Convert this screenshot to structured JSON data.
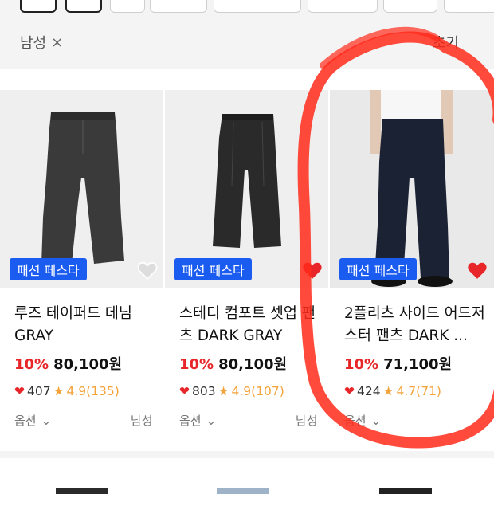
{
  "filter": {
    "active": "남성",
    "remove_icon": "×",
    "reset_label": "초기"
  },
  "products": [
    {
      "badge": "패션 페스타",
      "name": "루즈 테이퍼드 데님 GRAY",
      "discount": "10%",
      "price": "80,100원",
      "likes": "407",
      "rating": "4.9(135)",
      "option_label": "옵션",
      "gender": "남성",
      "liked": false
    },
    {
      "badge": "패션 페스타",
      "name": "스테디 컴포트 셋업 팬츠 DARK GRAY",
      "discount": "10%",
      "price": "80,100원",
      "likes": "803",
      "rating": "4.9(107)",
      "option_label": "옵션",
      "gender": "남성",
      "liked": true
    },
    {
      "badge": "패션 페스타",
      "name": "2플리츠 사이드 어드저스터 팬츠 DARK ...",
      "discount": "10%",
      "price": "71,100원",
      "likes": "424",
      "rating": "4.7(71)",
      "option_label": "옵션",
      "gender": "",
      "liked": true
    }
  ],
  "colors": {
    "accent_red": "#e8262a",
    "badge_blue": "#1a5bf0",
    "star": "#f3a33a",
    "annotation": "#ff2a1a"
  }
}
